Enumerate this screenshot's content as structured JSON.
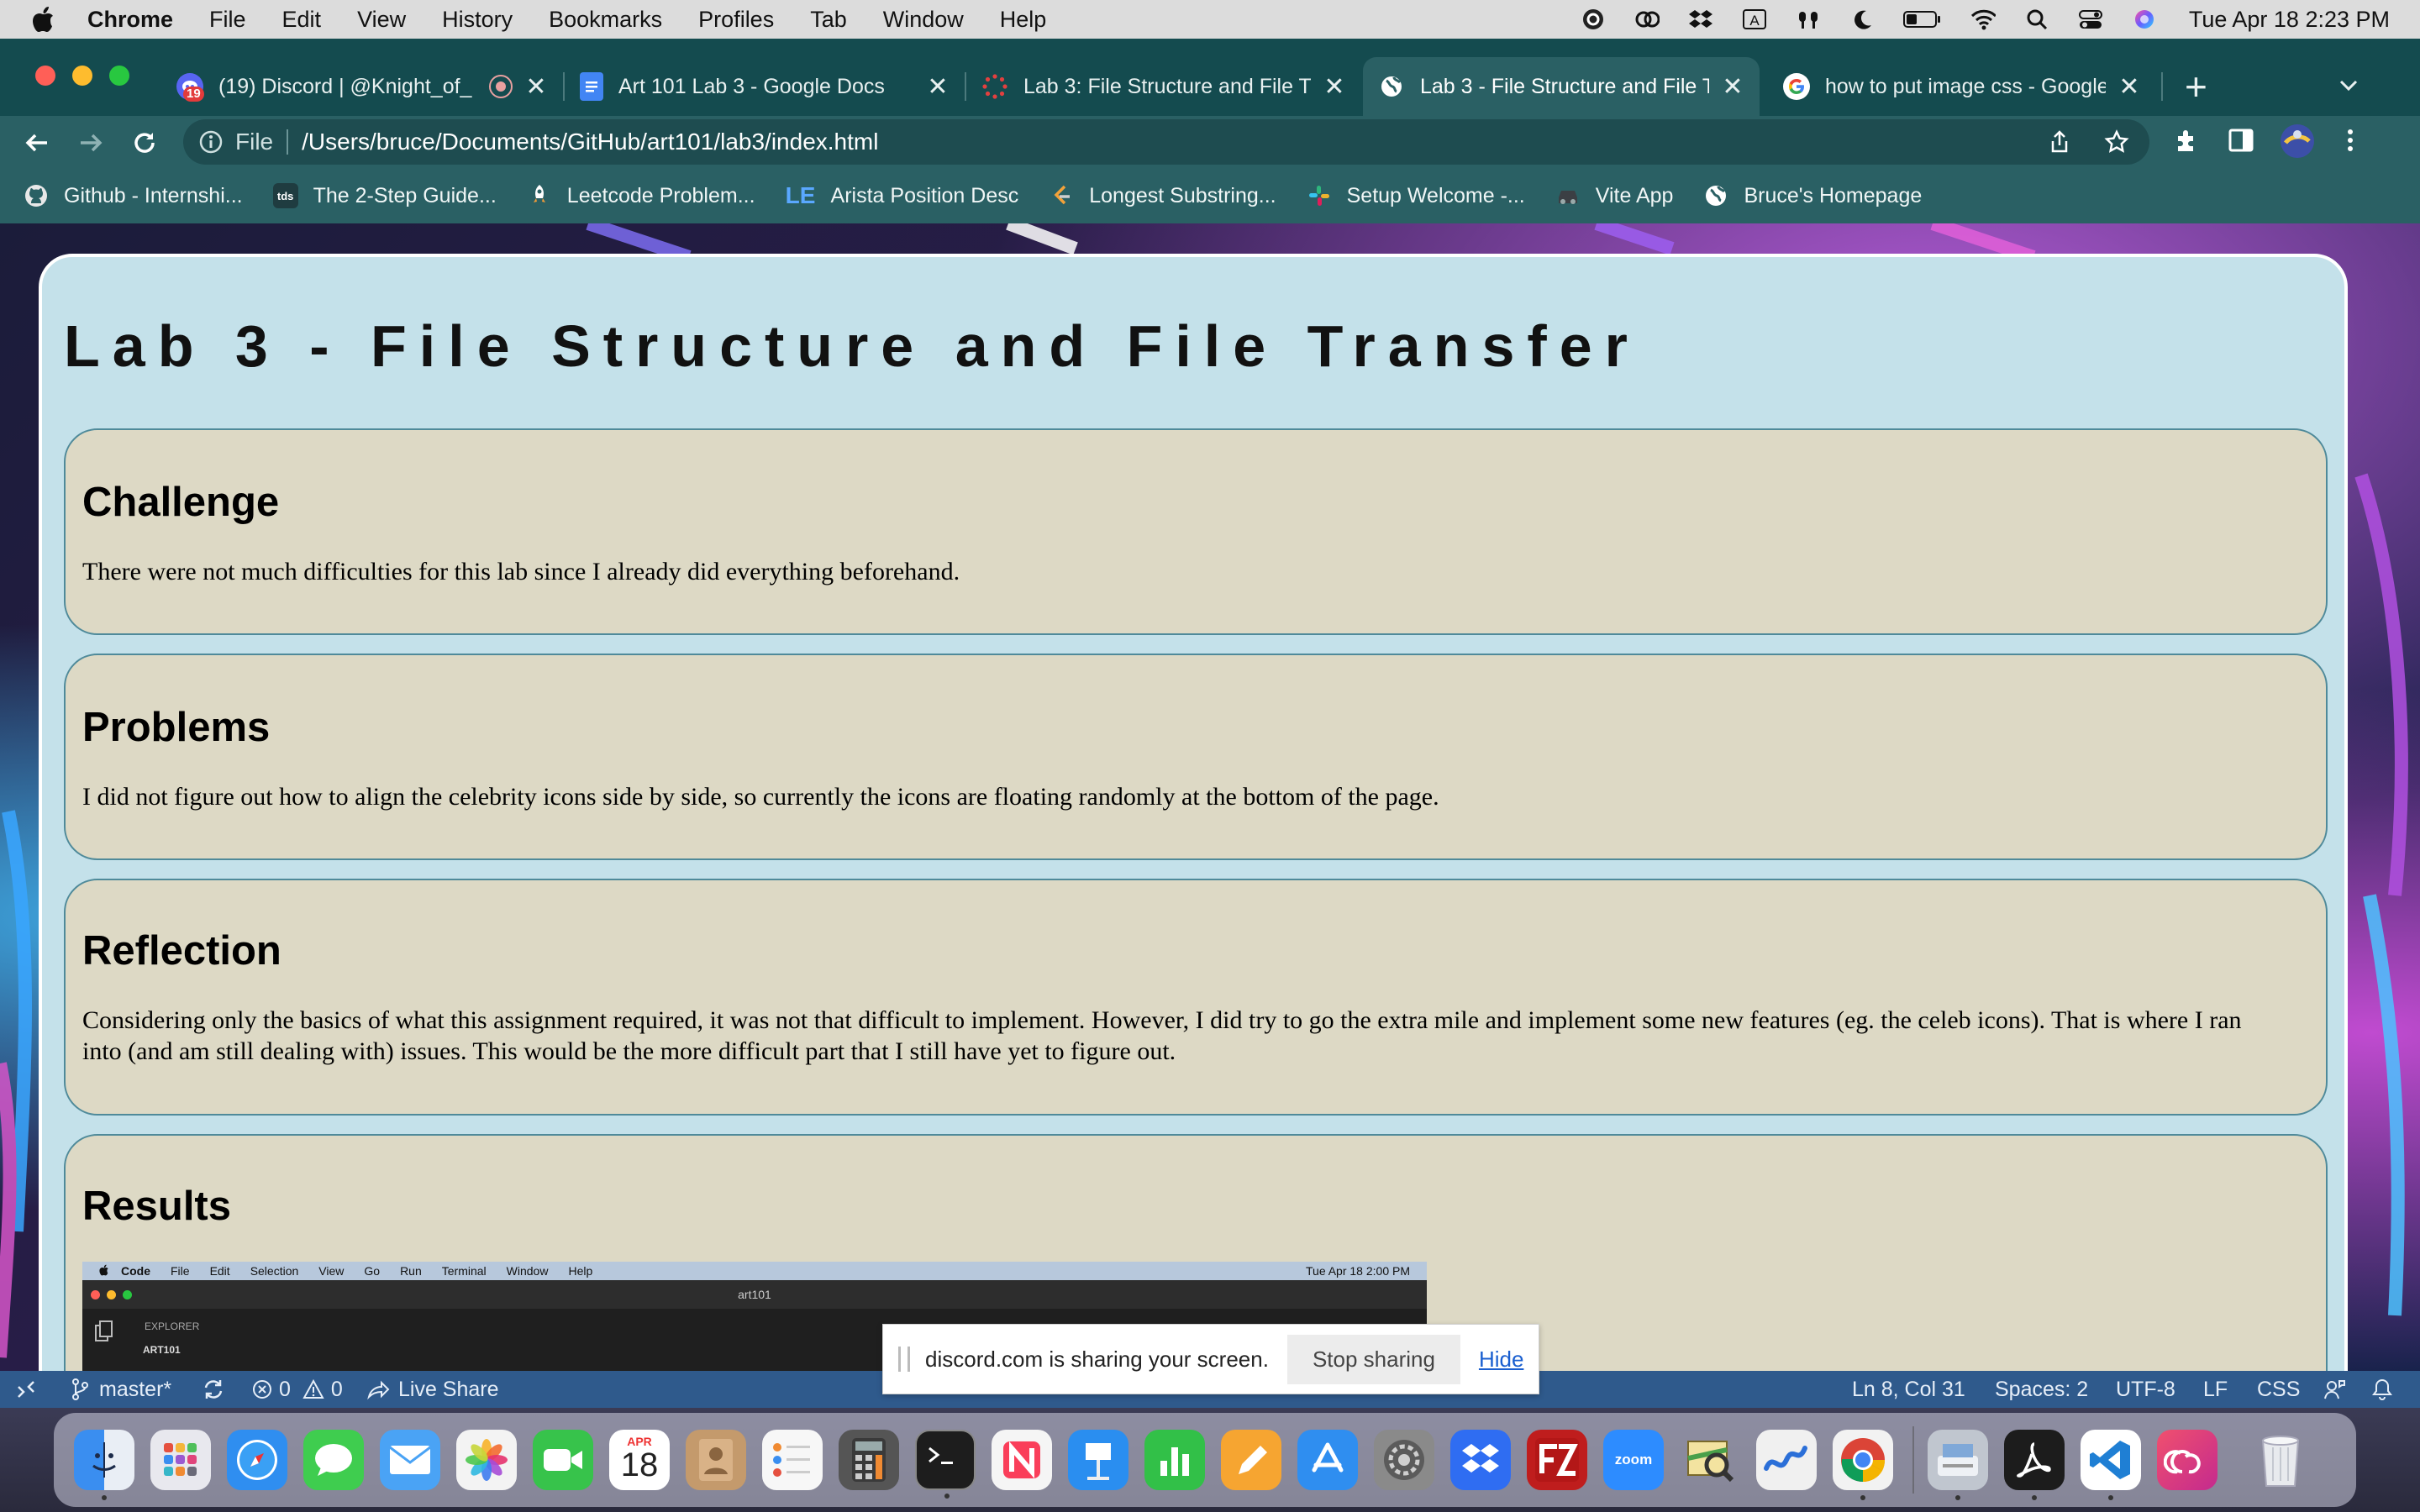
{
  "menubar": {
    "app": "Chrome",
    "items": [
      "File",
      "Edit",
      "View",
      "History",
      "Bookmarks",
      "Profiles",
      "Tab",
      "Window",
      "Help"
    ],
    "clock": "Tue Apr 18  2:23 PM",
    "status_icons": [
      "grammarly-icon",
      "creative-cloud-icon",
      "dropbox-icon",
      "input-source-icon",
      "airpods-icon",
      "focus-moon-icon",
      "battery-icon",
      "wifi-icon",
      "spotlight-icon",
      "control-center-icon",
      "siri-icon"
    ]
  },
  "tabs": [
    {
      "title": "(19) Discord | @Knight_of_",
      "badge": "19",
      "favicon": "discord-icon"
    },
    {
      "title": "Art 101 Lab 3 - Google Docs",
      "favicon": "google-docs-icon"
    },
    {
      "title": "Lab 3: File Structure and File Tr",
      "favicon": "canvas-icon"
    },
    {
      "title": "Lab 3 - File Structure and File T",
      "favicon": "globe-icon",
      "active": true
    },
    {
      "title": "how to put image css - Google",
      "favicon": "google-icon"
    }
  ],
  "address": {
    "scheme": "File",
    "url": "/Users/bruce/Documents/GitHub/art101/lab3/index.html"
  },
  "bookmarks": [
    {
      "label": "Github - Internshi...",
      "icon": "github-icon",
      "glyph": ""
    },
    {
      "label": "The 2-Step Guide...",
      "icon": "tds-icon",
      "glyph": "tds"
    },
    {
      "label": "Leetcode Problem...",
      "icon": "rocket-icon",
      "glyph": ""
    },
    {
      "label": "Arista Position Desc",
      "icon": "le-icon",
      "glyph": "LE"
    },
    {
      "label": "Longest Substring...",
      "icon": "leetcode-icon",
      "glyph": ""
    },
    {
      "label": "Setup Welcome -...",
      "icon": "slack-icon",
      "glyph": ""
    },
    {
      "label": "Vite App",
      "icon": "car-icon",
      "glyph": ""
    },
    {
      "label": "Bruce's Homepage",
      "icon": "globe-icon",
      "glyph": ""
    }
  ],
  "page": {
    "title": "Lab 3 - File Structure and File Transfer",
    "sections": [
      {
        "heading": "Challenge",
        "text": "There were not much difficulties for this lab since I already did everything beforehand."
      },
      {
        "heading": "Problems",
        "text": "I did not figure out how to align the celebrity icons side by side, so currently the icons are floating randomly at the bottom of the page."
      },
      {
        "heading": "Reflection",
        "text": "Considering only the basics of what this assignment required, it was not that difficult to implement. However, I did try to go the extra mile and implement some new features (eg. the celeb icons). That is where I ran into (and am still dealing with) issues. This would be the more difficult part that I still have yet to figure out."
      },
      {
        "heading": "Results",
        "text": ""
      }
    ],
    "results_screenshot": {
      "menu": [
        "Code",
        "File",
        "Edit",
        "Selection",
        "View",
        "Go",
        "Run",
        "Terminal",
        "Window",
        "Help"
      ],
      "clock": "Tue Apr 18  2:00 PM",
      "window_title": "art101",
      "explorer_label": "EXPLORER",
      "folder": "ART101"
    }
  },
  "share_banner": {
    "message": "discord.com is sharing your screen.",
    "stop_label": "Stop sharing",
    "hide_label": "Hide"
  },
  "statusbar": {
    "branch": "master*",
    "errors": "0",
    "warnings": "0",
    "live_share": "Live Share",
    "position": "Ln 8, Col 31",
    "spaces": "Spaces: 2",
    "encoding": "UTF-8",
    "eol": "LF",
    "language": "CSS"
  },
  "dock": {
    "calendar_month": "APR",
    "calendar_day": "18",
    "apps": [
      {
        "name": "finder-icon",
        "color": "#3d8ff0"
      },
      {
        "name": "launchpad-icon",
        "color": "#e8e8ee"
      },
      {
        "name": "safari-icon",
        "color": "#2f8ef0"
      },
      {
        "name": "messages-icon",
        "color": "#3fcd4f"
      },
      {
        "name": "mail-icon",
        "color": "#4aa3f5"
      },
      {
        "name": "photos-icon",
        "color": "#f3f3f3"
      },
      {
        "name": "facetime-icon",
        "color": "#37c34b"
      },
      {
        "name": "calendar-icon",
        "color": "#ffffff"
      },
      {
        "name": "contacts-icon",
        "color": "#c49a6c"
      },
      {
        "name": "reminders-icon",
        "color": "#f7f7f7"
      },
      {
        "name": "calculator-icon",
        "color": "#555555"
      },
      {
        "name": "terminal-icon",
        "color": "#1d1d1d"
      },
      {
        "name": "news-icon",
        "color": "#f5f5f5"
      },
      {
        "name": "keynote-icon",
        "color": "#2a8ef0"
      },
      {
        "name": "numbers-icon",
        "color": "#32c048"
      },
      {
        "name": "pages-icon",
        "color": "#f6a531"
      },
      {
        "name": "app-store-icon",
        "color": "#2f8ef0"
      },
      {
        "name": "system-settings-icon",
        "color": "#8a8a8a"
      },
      {
        "name": "dropbox-icon",
        "color": "#2f6df2"
      },
      {
        "name": "filezilla-icon",
        "color": "#bf1d1d"
      },
      {
        "name": "zoom-icon",
        "color": "#2d8cff"
      },
      {
        "name": "preview-icon",
        "color": "#c9b23a"
      },
      {
        "name": "freeform-icon",
        "color": "#f0f0f0"
      },
      {
        "name": "chrome-icon",
        "color": "#f2f2f2"
      },
      {
        "name": "image-capture-icon",
        "color": "#c0c6cf"
      },
      {
        "name": "acrobat-icon",
        "color": "#1c1c1c"
      },
      {
        "name": "vscode-icon",
        "color": "#ffffff"
      },
      {
        "name": "creative-cloud-icon",
        "color": "#e8386b"
      },
      {
        "name": "trash-icon",
        "color": "#e8eaee"
      }
    ]
  }
}
